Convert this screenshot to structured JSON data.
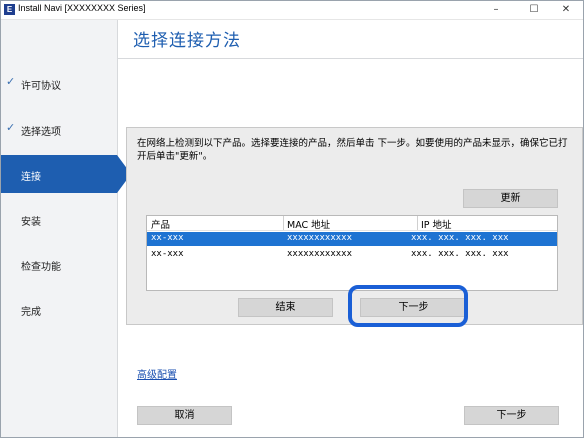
{
  "window": {
    "title": "Install Navi [XXXXXXXX Series]",
    "icon_letter": "E",
    "controls": [
      "–",
      "☐",
      "✕"
    ]
  },
  "sidebar": {
    "items": [
      {
        "label": "许可协议",
        "checked": true,
        "active": false
      },
      {
        "label": "选择选项",
        "checked": true,
        "active": false
      },
      {
        "label": "连接",
        "checked": false,
        "active": true
      },
      {
        "label": "安装",
        "checked": false,
        "active": false
      },
      {
        "label": "检查功能",
        "checked": false,
        "active": false
      },
      {
        "label": "完成",
        "checked": false,
        "active": false
      }
    ],
    "check_glyph": "✓"
  },
  "main": {
    "title": "选择连接方法",
    "description": "在网络上检测到以下产品。选择要连接的产品，然后单击 下一步。如要使用的产品未显示，确保它已打开后单击\"更新\"。",
    "refresh_label": "更新",
    "table": {
      "headers": [
        "产品",
        "MAC 地址",
        "IP 地址"
      ],
      "rows": [
        {
          "product": "xx-xxx",
          "mac": "xxxxxxxxxxxx",
          "ip": "xxx. xxx. xxx. xxx",
          "selected": true
        },
        {
          "product": "xx-xxx",
          "mac": "xxxxxxxxxxxx",
          "ip": "xxx. xxx. xxx. xxx",
          "selected": false
        }
      ]
    },
    "end_label": "结束",
    "next_label": "下一步",
    "advanced_link": "高级配置"
  },
  "footer": {
    "cancel_label": "取消",
    "next_label": "下一步"
  },
  "colors": {
    "accent": "#1e5eb0",
    "selection": "#1e73d2",
    "highlight_ring": "#1a5fd6"
  }
}
